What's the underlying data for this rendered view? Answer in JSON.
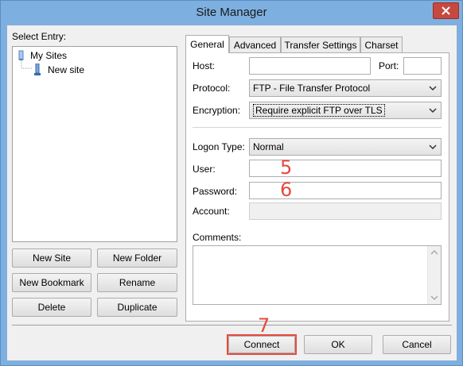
{
  "window": {
    "title": "Site Manager"
  },
  "left": {
    "select_entry_label": "Select Entry:",
    "tree": {
      "root": "My Sites",
      "child": "New site"
    },
    "buttons": {
      "new_site": "New Site",
      "new_folder": "New Folder",
      "new_bookmark": "New Bookmark",
      "rename": "Rename",
      "delete": "Delete",
      "duplicate": "Duplicate"
    }
  },
  "tabs": [
    "General",
    "Advanced",
    "Transfer Settings",
    "Charset"
  ],
  "general": {
    "host_label": "Host:",
    "host_value": "",
    "port_label": "Port:",
    "port_value": "",
    "protocol_label": "Protocol:",
    "protocol_value": "FTP - File Transfer Protocol",
    "encryption_label": "Encryption:",
    "encryption_value": "Require explicit FTP over TLS",
    "logon_type_label": "Logon Type:",
    "logon_type_value": "Normal",
    "user_label": "User:",
    "user_value": "",
    "password_label": "Password:",
    "password_value": "",
    "account_label": "Account:",
    "account_value": "",
    "comments_label": "Comments:",
    "comments_value": ""
  },
  "footer": {
    "connect": "Connect",
    "ok": "OK",
    "cancel": "Cancel"
  },
  "annotations": {
    "user": "5",
    "password": "6",
    "connect": "7"
  },
  "colors": {
    "annotation": "#e64a3f",
    "close_button": "#c7483f",
    "title_bar": "#7db0e0"
  }
}
